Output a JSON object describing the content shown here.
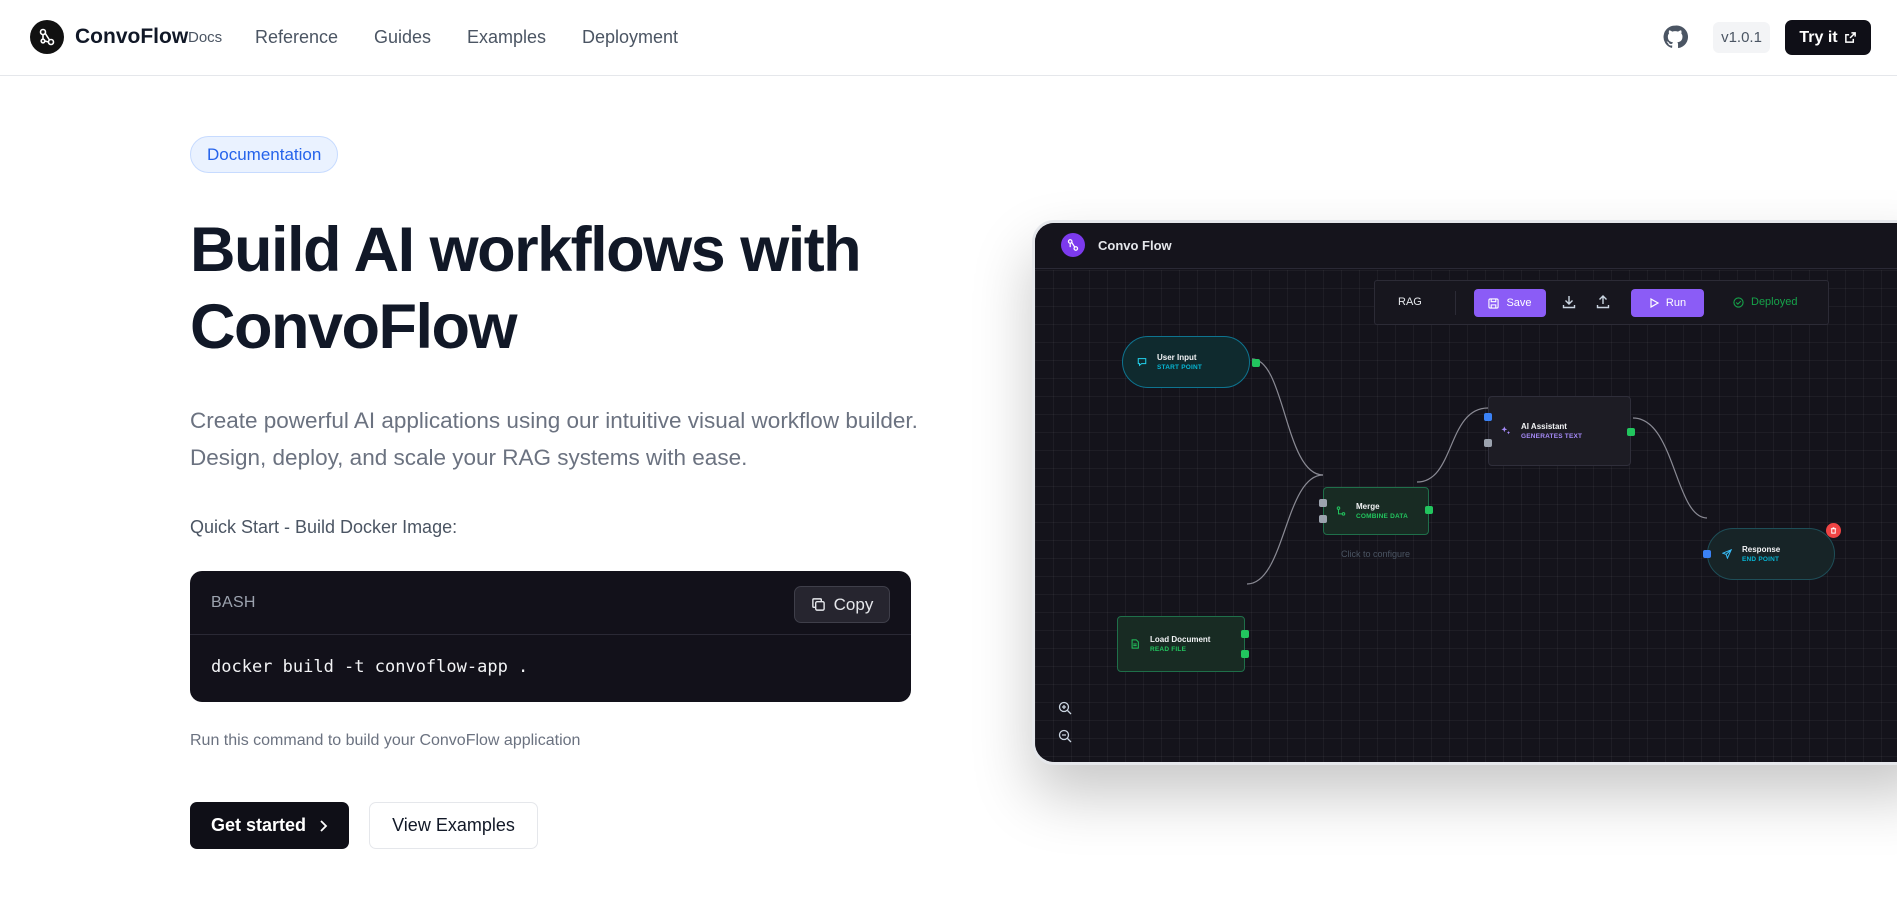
{
  "nav": {
    "brand": "ConvoFlow",
    "brand_sub": "Docs",
    "links": [
      "Reference",
      "Guides",
      "Examples",
      "Deployment"
    ],
    "version": "v1.0.1",
    "try_it": "Try it"
  },
  "hero": {
    "badge": "Documentation",
    "title_line1": "Build AI workflows with",
    "title_line2": "ConvoFlow",
    "description": "Create powerful AI applications using our intuitive visual workflow builder. Design, deploy, and scale your RAG systems with ease.",
    "quickstart_label": "Quick Start - Build Docker Image:",
    "code_lang": "BASH",
    "copy_label": "Copy",
    "code": "docker build -t convoflow-app .",
    "run_note": "Run this command to build your ConvoFlow application",
    "primary_button": "Get started",
    "secondary_button": "View Examples"
  },
  "app_preview": {
    "app_name": "Convo Flow",
    "toolbar": {
      "workflow_name": "RAG",
      "save": "Save",
      "run": "Run",
      "status": "Deployed"
    },
    "nodes": {
      "user_input": {
        "title": "User Input",
        "subtitle": "START POINT"
      },
      "merge": {
        "title": "Merge",
        "subtitle": "COMBINE DATA"
      },
      "ai_assistant": {
        "title": "AI Assistant",
        "subtitle": "GENERATES TEXT"
      },
      "response": {
        "title": "Response",
        "subtitle": "END POINT"
      },
      "load_document": {
        "title": "Load Document",
        "subtitle": "READ FILE"
      }
    },
    "hint": "Click to configure"
  },
  "colors": {
    "accent_purple": "#8b5cf6",
    "start_cyan": "#06b6d4",
    "green": "#22c55e",
    "blue_port": "#3b82f6",
    "danger": "#ef4444",
    "badge_blue": "#2563eb"
  }
}
